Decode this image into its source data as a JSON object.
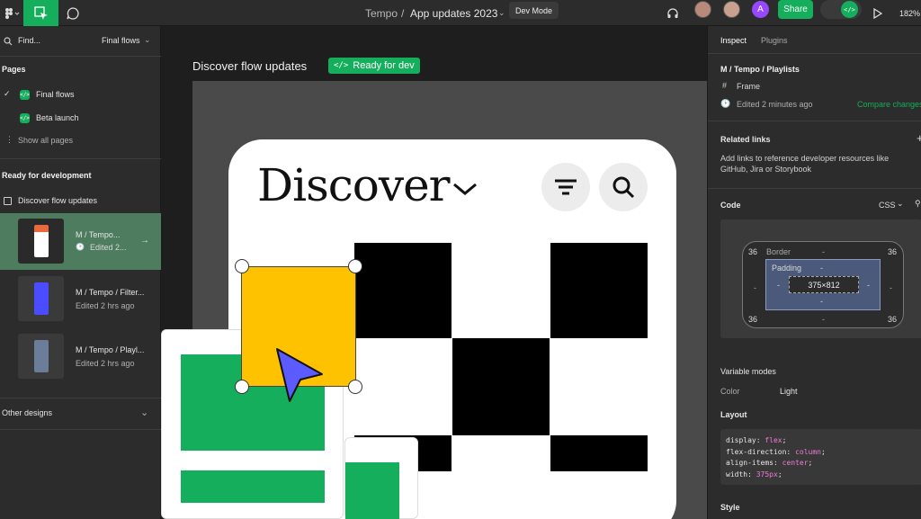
{
  "topbar": {
    "breadcrumb_project": "Tempo",
    "breadcrumb_sep": "/",
    "breadcrumb_file": "App updates 2023",
    "dev_mode_label": "Dev Mode",
    "avatar_letter": "A",
    "share_label": "Share",
    "zoom": "182%"
  },
  "left": {
    "search_placeholder": "Find...",
    "page_selector": "Final flows",
    "pages_heading": "Pages",
    "pages": [
      {
        "label": "Final flows",
        "selected": true
      },
      {
        "label": "Beta launch",
        "selected": false
      }
    ],
    "show_all_pages": "Show all pages",
    "ready_heading": "Ready for development",
    "section_label": "Discover flow updates",
    "frames": [
      {
        "title": "M / Tempo...",
        "subtitle": "Edited 2...",
        "thumb_color": "#e86a3c"
      },
      {
        "title": "M / Tempo / Filter...",
        "subtitle": "Edited 2 hrs ago",
        "thumb_color": "#4b4bff"
      },
      {
        "title": "M / Tempo / Playl...",
        "subtitle": "Edited 2 hrs ago",
        "thumb_color": "#6b7d99"
      }
    ],
    "other_designs": "Other designs"
  },
  "canvas": {
    "frame_title": "Discover flow updates",
    "ready_badge": "Ready for dev",
    "mock_heading": "Discover"
  },
  "right": {
    "tab_inspect": "Inspect",
    "tab_plugins": "Plugins",
    "frame_name": "M / Tempo / Playlists",
    "frame_type": "Frame",
    "edited": "Edited 2 minutes ago",
    "compare_changes": "Compare changes",
    "related_links_heading": "Related links",
    "related_links_desc_1": "Add links to reference developer resources like",
    "related_links_desc_2": "GitHub, Jira or Storybook",
    "code_heading": "Code",
    "code_lang": "CSS",
    "box": {
      "margin_top_left": "36",
      "margin_top_right": "36",
      "margin_bottom_left": "36",
      "margin_bottom_right": "36",
      "border_label": "Border",
      "padding_label": "Padding",
      "size": "375×812",
      "dash": "-"
    },
    "variable_modes_heading": "Variable modes",
    "color_label": "Color",
    "color_value": "Light",
    "layout_heading": "Layout",
    "code_lines": [
      {
        "prop": "display: ",
        "val": "flex",
        "end": ";"
      },
      {
        "prop": "flex-direction: ",
        "val": "column",
        "end": ";"
      },
      {
        "prop": "align-items: ",
        "val": "center",
        "end": ";"
      },
      {
        "prop": "width: ",
        "val": "375px",
        "end": ";"
      }
    ],
    "style_heading": "Style"
  },
  "colors": {
    "accent_green": "#14ae5c",
    "selection_blue": "#0d99ff",
    "mock_yellow": "#ffc200",
    "mock_green": "#14ae5c",
    "cursor_purple": "#5b5bff"
  }
}
